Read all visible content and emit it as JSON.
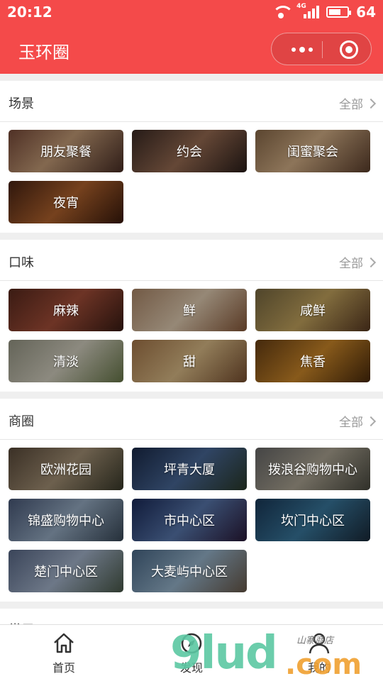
{
  "status": {
    "time": "20:12",
    "network": "4G",
    "battery": "64",
    "battery_level": 0.64
  },
  "navbar": {
    "title": "玉环圈"
  },
  "colors": {
    "brand": "#f44a4a",
    "watermark_green": "#5cc8a3",
    "watermark_orange": "#f0a030"
  },
  "sections": [
    {
      "title": "场景",
      "more": "全部",
      "tiles": [
        {
          "label": "朋友聚餐",
          "bg": "linear-gradient(135deg,#7a4b3a,#c9a07a 45%,#4a2e25)"
        },
        {
          "label": "约会",
          "bg": "linear-gradient(135deg,#3b2a24,#9b6e54 50%,#2b1e1a)"
        },
        {
          "label": "闺蜜聚会",
          "bg": "linear-gradient(135deg,#8c6b4a,#d9b48a 45%,#5d3f2c)"
        },
        {
          "label": "夜宵",
          "bg": "linear-gradient(135deg,#4a2414,#b5652e 50%,#3a1a0c)"
        }
      ]
    },
    {
      "title": "口味",
      "more": "全部",
      "tiles": [
        {
          "label": "麻辣",
          "bg": "linear-gradient(135deg,#5a2a1e,#a8503a 50%,#3a1c14)"
        },
        {
          "label": "鲜",
          "bg": "linear-gradient(135deg,#b08a6a,#e6d1b6 50%,#8a5a3a)"
        },
        {
          "label": "咸鲜",
          "bg": "linear-gradient(135deg,#7a6a42,#c8a860 50%,#5a3a22)"
        },
        {
          "label": "清淡",
          "bg": "linear-gradient(135deg,#9a9a88,#d8d4c4 50%,#6a7a4a)"
        },
        {
          "label": "甜",
          "bg": "linear-gradient(135deg,#a8784a,#e0c08a 50%,#7a5030)"
        },
        {
          "label": "焦香",
          "bg": "linear-gradient(135deg,#6a4014,#d08a2a 50%,#4a2a0a)"
        }
      ]
    },
    {
      "title": "商圈",
      "more": "全部",
      "tiles": [
        {
          "label": "欧洲花园",
          "bg": "linear-gradient(135deg,#5a4a3a,#a89478 50%,#3a3a2a)"
        },
        {
          "label": "坪青大厦",
          "bg": "linear-gradient(135deg,#1a2a4a,#4a6a9a 50%,#2a3a2a)"
        },
        {
          "label": "拨浪谷购物中心",
          "bg": "linear-gradient(135deg,#6a6a6a,#b0a896 50%,#4a4a40)"
        },
        {
          "label": "锦盛购物中心",
          "bg": "linear-gradient(135deg,#4a5a7a,#9ab0c8 50%,#3a4a5a)"
        },
        {
          "label": "市中心区",
          "bg": "linear-gradient(135deg,#1a2a5a,#5a7ab0 50%,#2a1a3a)"
        },
        {
          "label": "坎门中心区",
          "bg": "linear-gradient(135deg,#1a3a5a,#3a7aa0 50%,#1a2a3a)"
        },
        {
          "label": "楚门中心区",
          "bg": "linear-gradient(135deg,#5a6a8a,#a8b8d0 50%,#4a5a4a)"
        },
        {
          "label": "大麦屿中心区",
          "bg": "linear-gradient(135deg,#4a6a8a,#9ab8d0 50%,#6a5a4a)"
        }
      ]
    }
  ],
  "next_section": {
    "title": "常用"
  },
  "tabbar": {
    "tabs": [
      {
        "label": "首页",
        "icon": "home-icon"
      },
      {
        "label": "发现",
        "icon": "compass-icon"
      },
      {
        "label": "我的",
        "icon": "user-icon"
      }
    ]
  },
  "watermark": {
    "text": "9lud",
    "suffix": ".com",
    "tag": "山寨商店"
  }
}
